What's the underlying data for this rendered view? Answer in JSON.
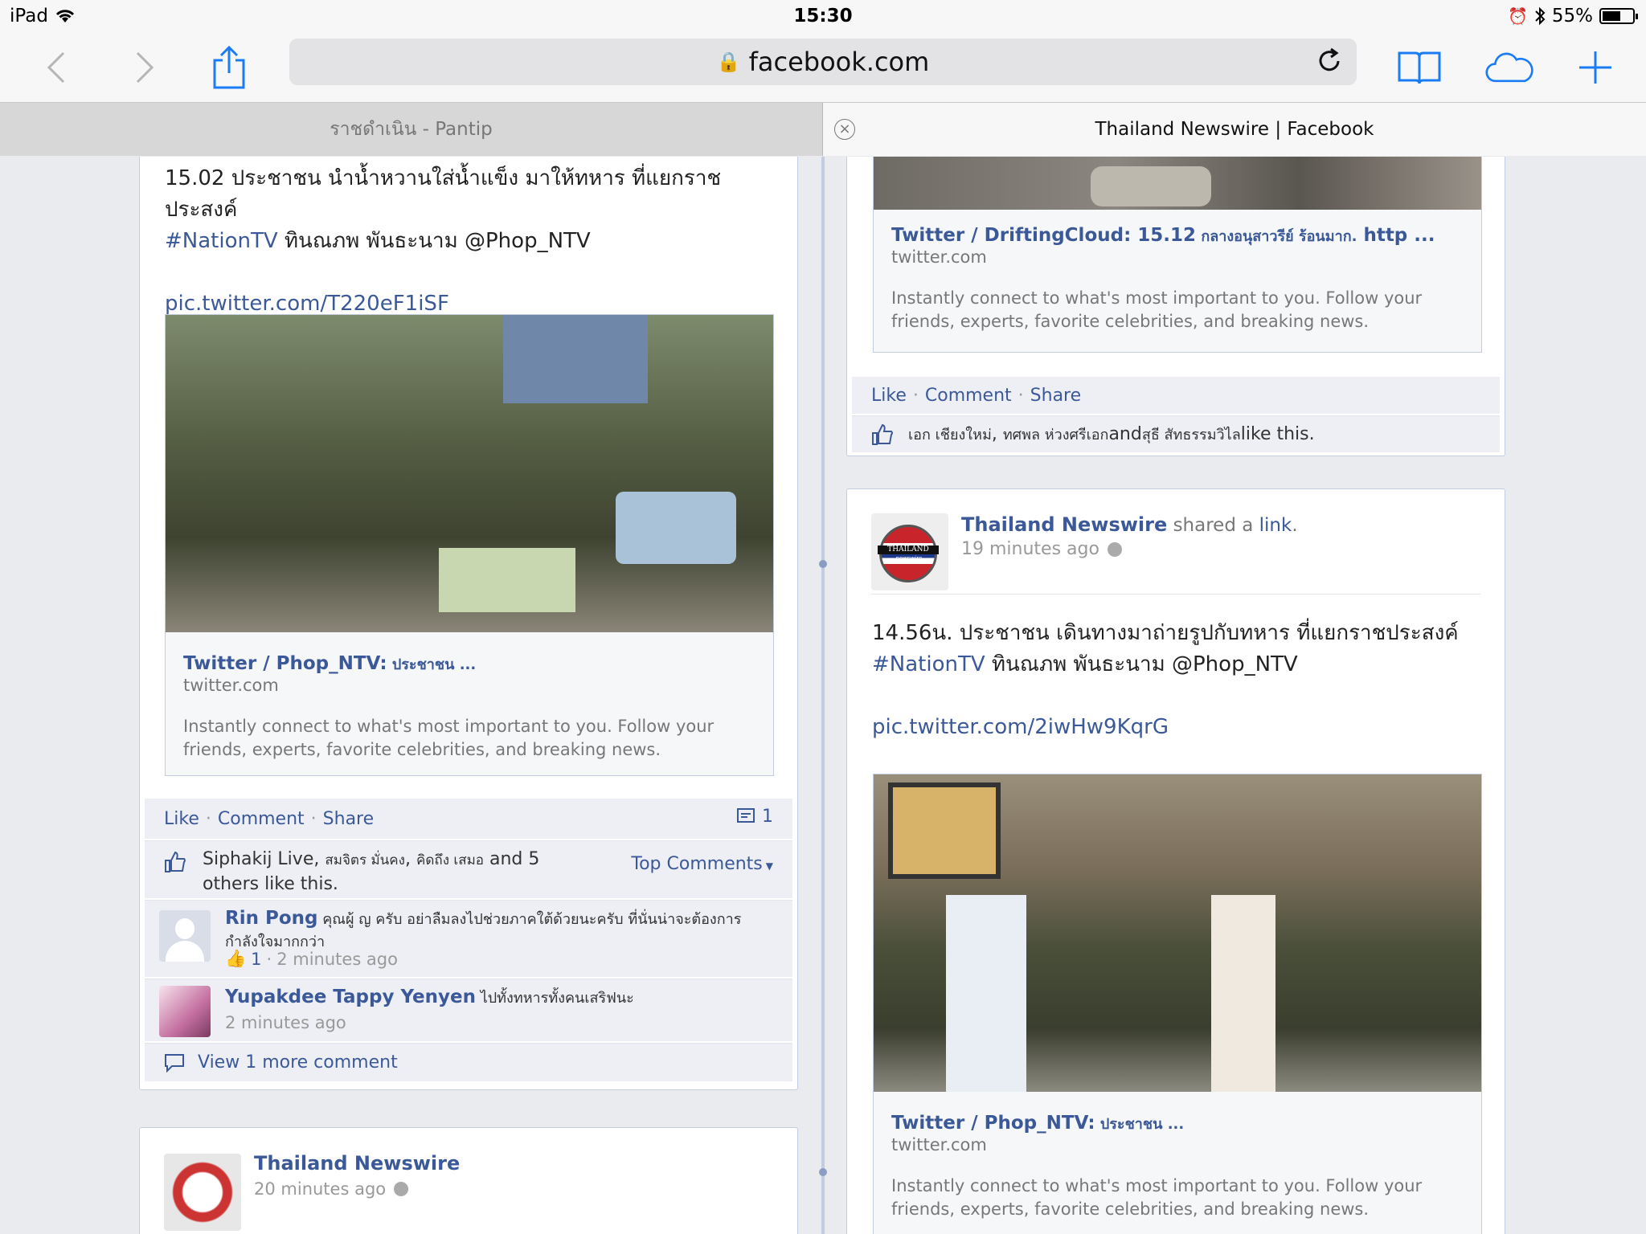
{
  "status": {
    "device": "iPad",
    "time": "15:30",
    "battery": "55%"
  },
  "toolbar": {
    "url": "facebook.com"
  },
  "tabs": [
    {
      "label": "ราชดำเนิน - Pantip"
    },
    {
      "label": "Thailand Newswire | Facebook"
    }
  ],
  "left_post": {
    "line1": "15.02 ประชาชน นำน้ำหวานใส่น้ำแข็ง มาให้ทหาร ที่แยกราชประสงค์",
    "hashtag": "#NationTV",
    "line2": " ทินณภพ พันธะนาม @Phop_NTV",
    "pic_link": "pic.twitter.com/T220eF1iSF",
    "att_title": "Twitter / Phop_NTV:",
    "att_title_th": " ประชาชน ...",
    "att_domain": "twitter.com",
    "att_desc": "Instantly connect to what's most important to you. Follow your friends, experts, favorite celebrities, and breaking news.",
    "actions": {
      "like": "Like",
      "comment": "Comment",
      "share": "Share",
      "count": "1"
    },
    "likes": {
      "n1": "Siphakij Live",
      "n2": "สมจิตร มั่นคง",
      "n3": "คิดถึง เสมอ",
      "and": " and ",
      "others_a": "5",
      "others_b": "others",
      "tail": " like this."
    },
    "top_comments": "Top Comments",
    "comments": [
      {
        "name": "Rin Pong",
        "text": " คุณผู้ ญ ครับ อย่าลืมลงไปช่วยภาคใต้ด้วยนะครับ ที่นั่นน่าจะต้องการกำลังใจมากกว่า",
        "likes": "1",
        "time": "2 minutes ago"
      },
      {
        "name": "Yupakdee Tappy Yenyen",
        "text": " ไปทั้งทหารทั้งคนเสริฟนะ",
        "time": "2 minutes ago"
      }
    ],
    "view_more": "View 1 more comment"
  },
  "left_post2": {
    "name": "Thailand Newswire",
    "time": "20 minutes ago"
  },
  "right_top": {
    "att_title": "Twitter / DriftingCloud: 15.12",
    "att_title_th": " กลางอนุสาวรีย์ ร้อนมาก.",
    "att_title_end": " http ...",
    "att_domain": "twitter.com",
    "att_desc": "Instantly connect to what's most important to you. Follow your friends, experts, favorite celebrities, and breaking news.",
    "actions": {
      "like": "Like",
      "comment": "Comment",
      "share": "Share"
    },
    "likes": {
      "n1": "เอก เชียงใหม่",
      "n2": "ทศพล ห่วงศรีเอก",
      "and": " and ",
      "n3": "สุธี สัทธรรมวิไล",
      "tail": " like this."
    }
  },
  "right_post": {
    "name": "Thailand Newswire",
    "shared": " shared a ",
    "link_word": "link",
    "time": "19 minutes ago",
    "avatar_label": "THAILAND",
    "avatar_sub": "newswire",
    "line1": "14.56น. ประชาชน เดินทางมาถ่ายรูปกับทหาร ที่แยกราชประสงค์",
    "hashtag": "#NationTV",
    "line2": " ทินณภพ พันธะนาม @Phop_NTV",
    "pic_link": "pic.twitter.com/2iwHw9KqrG",
    "att_title": "Twitter / Phop_NTV:",
    "att_title_th": " ประชาชน ...",
    "att_domain": "twitter.com",
    "att_desc": "Instantly connect to what's most important to you. Follow your friends, experts, favorite celebrities, and breaking news."
  }
}
